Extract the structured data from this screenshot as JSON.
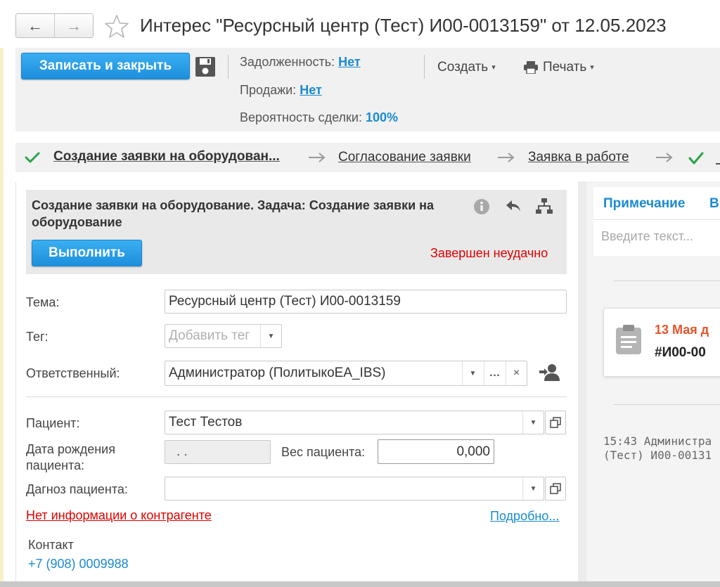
{
  "header": {
    "title": "Интерес \"Ресурсный центр (Тест) И00-0013159\" от 12.05.2023",
    "back_glyph": "←",
    "forward_glyph": "→"
  },
  "toolbar": {
    "save_close_label": "Записать и закрыть",
    "debt_label": "Задолженность:",
    "debt_value": "Нет",
    "sales_label": "Продажи:",
    "sales_value": "Нет",
    "probability_label": "Вероятность сделки:",
    "probability_value": "100%",
    "create_label": "Создать",
    "print_label": "Печать"
  },
  "stages": {
    "items": [
      {
        "label": "Создание заявки на оборудован...",
        "done": true,
        "current": true
      },
      {
        "label": "Согласование заявки",
        "done": false
      },
      {
        "label": "Заявка в работе",
        "done": false
      }
    ]
  },
  "task": {
    "title": "Создание заявки на оборудование. Задача: Создание заявки на оборудование",
    "execute_label": "Выполнить",
    "status": "Завершен неудачно"
  },
  "form": {
    "topic_label": "Тема:",
    "topic_value": "Ресурсный центр (Тест) И00-0013159",
    "tag_label": "Тег:",
    "tag_placeholder": "Добавить тег",
    "responsible_label": "Ответственный:",
    "responsible_value": "Администратор (ПолитыкоЕА_IBS)",
    "patient_label": "Пациент:",
    "patient_value": "Тест Тестов",
    "birthdate_label": "Дата рождения пациента:",
    "birthdate_value": ". .",
    "weight_label": "Вес пациента:",
    "weight_value": "0,000",
    "diagnosis_label": "Дагноз пациента:",
    "diagnosis_value": "",
    "no_contractor_info": "Нет информации о контрагенте",
    "details_link": "Подробно...",
    "contact_label": "Контакт",
    "contact_phone": "+7 (908) 0009988"
  },
  "right_panel": {
    "tab_note": "Примечание",
    "tab_other": "В",
    "note_placeholder": "Введите текст...",
    "event_date": "13 Мая д",
    "event_id": "#И00-00",
    "log_line1": "15:43 Администра",
    "log_line2": "(Тест) И00-00131"
  },
  "colors": {
    "accent": "#1a8bd1",
    "primary_button": "#2ea3ea",
    "error": "#e00000",
    "event_date": "#e8542a",
    "check": "#2aa34a"
  }
}
